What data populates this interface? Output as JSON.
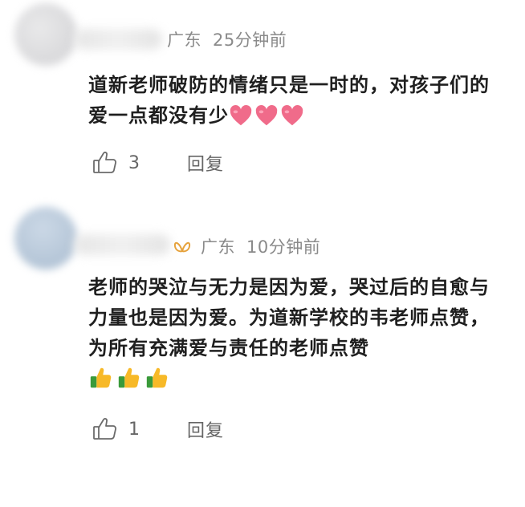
{
  "comments": [
    {
      "location": "广东",
      "time": "25分钟前",
      "text": "道新老师破防的情绪只是一时的，对孩子们的爱一点都没有少",
      "emoji": [
        "red-heart",
        "red-heart",
        "red-heart"
      ],
      "likes": "3",
      "reply_label": "回复"
    },
    {
      "location": "广东",
      "time": "10分钟前",
      "text": "老师的哭泣与无力是因为爱，哭过后的自愈与力量也是因为爱。为道新学校的韦老师点赞，为所有充满爱与责任的老师点赞",
      "emoji": [
        "thumbs-up",
        "thumbs-up",
        "thumbs-up"
      ],
      "likes": "1",
      "reply_label": "回复"
    }
  ],
  "colors": {
    "meta": "#8a8a8a",
    "text": "#1f1f1f",
    "heart": "#f06b8a",
    "badge": "#e6a23c"
  }
}
